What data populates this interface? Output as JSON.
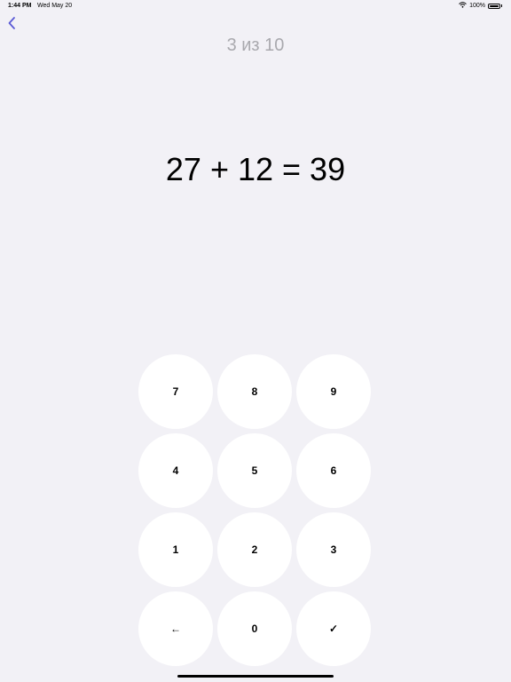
{
  "status_bar": {
    "time": "1:44 PM",
    "date": "Wed May 20",
    "battery_text": "100%",
    "battery_level": 1.0
  },
  "nav": {
    "back_icon": "chevron-left-icon",
    "accent_color": "#5b5bd6"
  },
  "progress": {
    "title": "3 из 10"
  },
  "question": {
    "equation": "27 + 12 = 39"
  },
  "keypad": {
    "keys": [
      {
        "label": "7",
        "name": "key-7"
      },
      {
        "label": "8",
        "name": "key-8"
      },
      {
        "label": "9",
        "name": "key-9"
      },
      {
        "label": "4",
        "name": "key-4"
      },
      {
        "label": "5",
        "name": "key-5"
      },
      {
        "label": "6",
        "name": "key-6"
      },
      {
        "label": "1",
        "name": "key-1"
      },
      {
        "label": "2",
        "name": "key-2"
      },
      {
        "label": "3",
        "name": "key-3"
      },
      {
        "label": "←",
        "name": "backspace-button"
      },
      {
        "label": "0",
        "name": "key-0"
      },
      {
        "label": "✓",
        "name": "submit-button"
      }
    ]
  },
  "colors": {
    "background": "#f2f1f6",
    "key_background": "#ffffff",
    "title_gray": "#a9a9ae"
  }
}
